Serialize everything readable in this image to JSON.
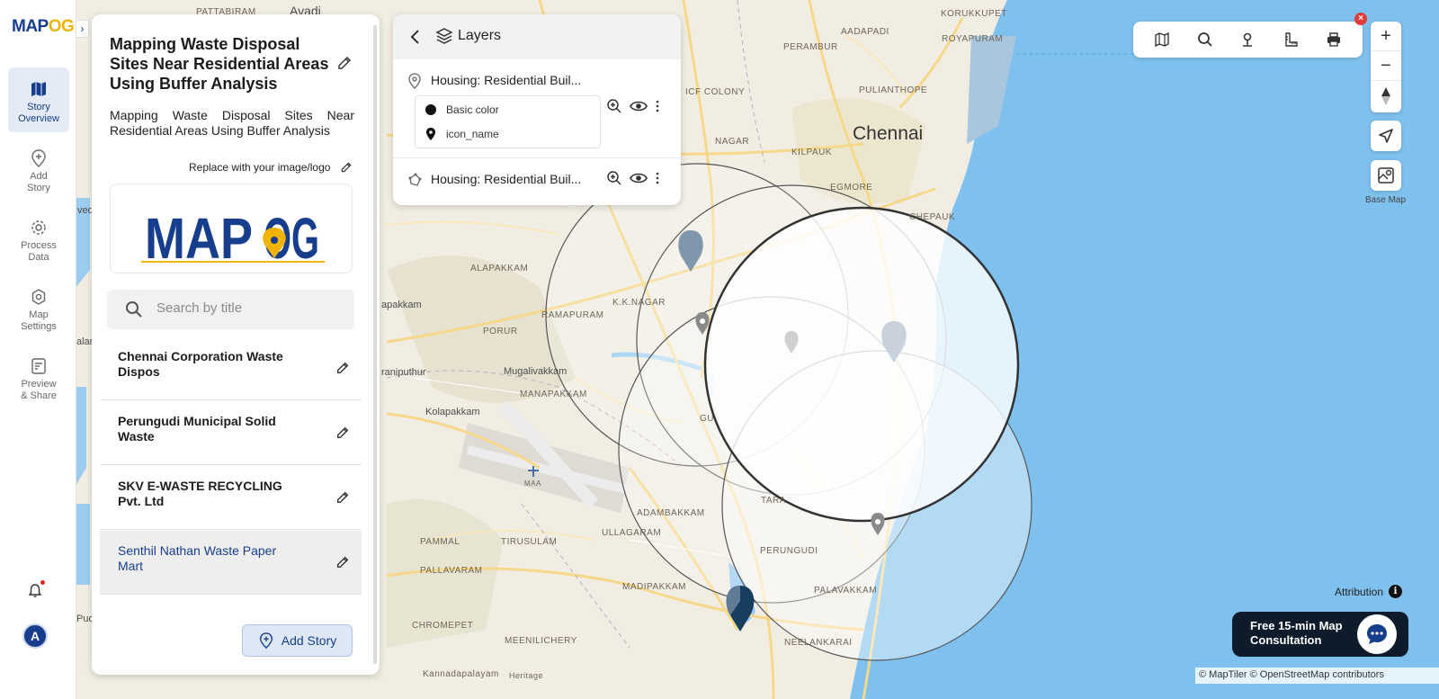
{
  "app": {
    "logo_main": "MAP",
    "logo_accent": "OG"
  },
  "nav": {
    "items": [
      {
        "label": "Story\nOverview",
        "icon": "map-icon",
        "active": true
      },
      {
        "label": "Add\nStory",
        "icon": "add-location-icon",
        "active": false
      },
      {
        "label": "Process\nData",
        "icon": "gear-icon",
        "active": false
      },
      {
        "label": "Map\nSettings",
        "icon": "settings-icon",
        "active": false
      },
      {
        "label": "Preview\n& Share",
        "icon": "preview-icon",
        "active": false
      }
    ],
    "avatar_initial": "A"
  },
  "story": {
    "title": "Mapping Waste Disposal Sites Near Residential Areas Using Buffer Analysis",
    "description": "Mapping Waste Disposal Sites Near Residential Areas Using Buffer Analysis",
    "replace_label": "Replace with your image/logo",
    "logo_main": "MAP",
    "logo_accent": "OG",
    "search_placeholder": "Search by title",
    "items": [
      {
        "label": "Chennai Corporation Waste Dispos",
        "selected": false
      },
      {
        "label": "Perungudi Municipal Solid Waste",
        "selected": false
      },
      {
        "label": "SKV E-WASTE RECYCLING Pvt. Ltd",
        "selected": false
      },
      {
        "label": "Senthil Nathan Waste Paper Mart",
        "selected": true
      }
    ],
    "add_button": "Add Story"
  },
  "layers": {
    "title": "Layers",
    "rows": [
      {
        "name": "Housing: Residential Buil...",
        "type": "point-icon"
      },
      {
        "name": "Housing: Residential Buil...",
        "type": "polygon-icon"
      }
    ],
    "legend": [
      {
        "label": "Basic color",
        "icon": "filled-circle-icon"
      },
      {
        "label": "icon_name",
        "icon": "marker-icon"
      }
    ]
  },
  "map": {
    "city_label": "Chennai",
    "place_labels": [
      "Avadi",
      "PATTABIRAM",
      "KORUKKUPET",
      "ROYAPURAM",
      "PERAMBUR",
      "PULIANTHOPE",
      "ICF COLONY",
      "KILPAUK",
      "EGMORE",
      "CHEPAUK",
      "ALAPAKKAM",
      "K.K.NAGAR",
      "PORUR",
      "RAMAPURAM",
      "Mugalivakkam",
      "MANAPAKKAM",
      "Kolapakkam",
      "MAA",
      "ADAMBAKKAM",
      "ULLAGARAM",
      "PAMMAL",
      "TIRUSULAM",
      "PALLAVARAM",
      "MADIPAKKAM",
      "PERUNGUDI",
      "PALAVAKKAM",
      "CHROMEPET",
      "MEENILICHERY",
      "NEELANKARAI",
      "Kannadapalayam",
      "Heritage",
      "raniputhur",
      "apakkam",
      "Puc",
      "alar",
      "ved",
      "TARA",
      "GU",
      "AADAPADI",
      "NAGAR"
    ],
    "attribution": "Attribution",
    "copyright": "© MapTiler © OpenStreetMap contributors",
    "colors": {
      "land": "#f2efe6",
      "water": "#7fc1ee",
      "road": "#f7d77a",
      "buffer_stroke": "#555555",
      "marker": "#7f96ad",
      "marker_dark": "#173e5e"
    }
  },
  "toolbar": {
    "icons": [
      "map-layers-icon",
      "search-icon",
      "pin-icon",
      "measure-icon",
      "print-icon"
    ]
  },
  "controls": {
    "zoom_in": "+",
    "zoom_out": "−",
    "basemap_label": "Base Map"
  },
  "consult": {
    "text": "Free 15-min Map Consultation"
  }
}
